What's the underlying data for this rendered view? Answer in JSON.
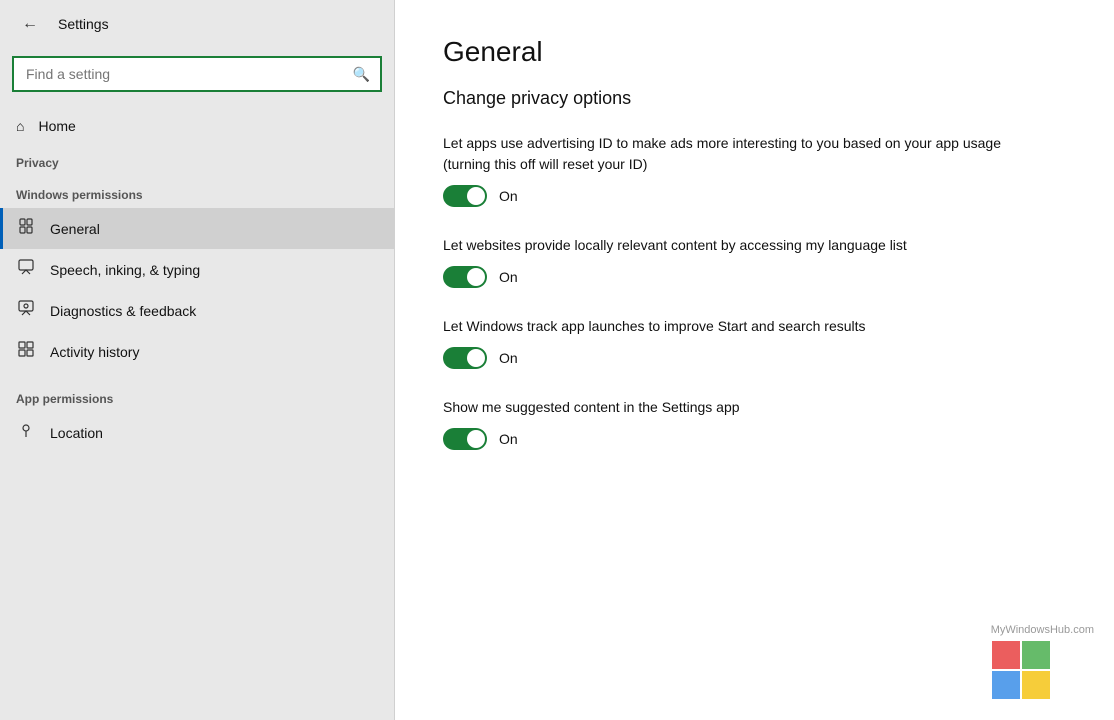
{
  "titlebar": {
    "title": "Settings",
    "back_label": "←"
  },
  "search": {
    "placeholder": "Find a setting",
    "icon": "🔍"
  },
  "sidebar": {
    "home_label": "Home",
    "privacy_label": "Privacy",
    "windows_permissions_label": "Windows permissions",
    "app_permissions_label": "App permissions",
    "nav_items": [
      {
        "id": "general",
        "label": "General",
        "icon": "shield",
        "active": true
      },
      {
        "id": "speech",
        "label": "Speech, inking, & typing",
        "icon": "speech",
        "active": false
      },
      {
        "id": "diagnostics",
        "label": "Diagnostics & feedback",
        "icon": "diag",
        "active": false
      },
      {
        "id": "activity",
        "label": "Activity history",
        "icon": "activity",
        "active": false
      }
    ],
    "app_items": [
      {
        "id": "location",
        "label": "Location",
        "icon": "location",
        "active": false
      }
    ]
  },
  "main": {
    "page_title": "General",
    "section_title": "Change privacy options",
    "settings": [
      {
        "id": "advertising",
        "description": "Let apps use advertising ID to make ads more interesting to you based on your app usage (turning this off will reset your ID)",
        "state": "On",
        "enabled": true
      },
      {
        "id": "language",
        "description": "Let websites provide locally relevant content by accessing my language list",
        "state": "On",
        "enabled": true
      },
      {
        "id": "track",
        "description": "Let Windows track app launches to improve Start and search results",
        "state": "On",
        "enabled": true
      },
      {
        "id": "suggested",
        "description": "Show me suggested content in the Settings app",
        "state": "On",
        "enabled": true
      }
    ]
  },
  "watermark": {
    "text": "MyWindowsHub.com"
  }
}
